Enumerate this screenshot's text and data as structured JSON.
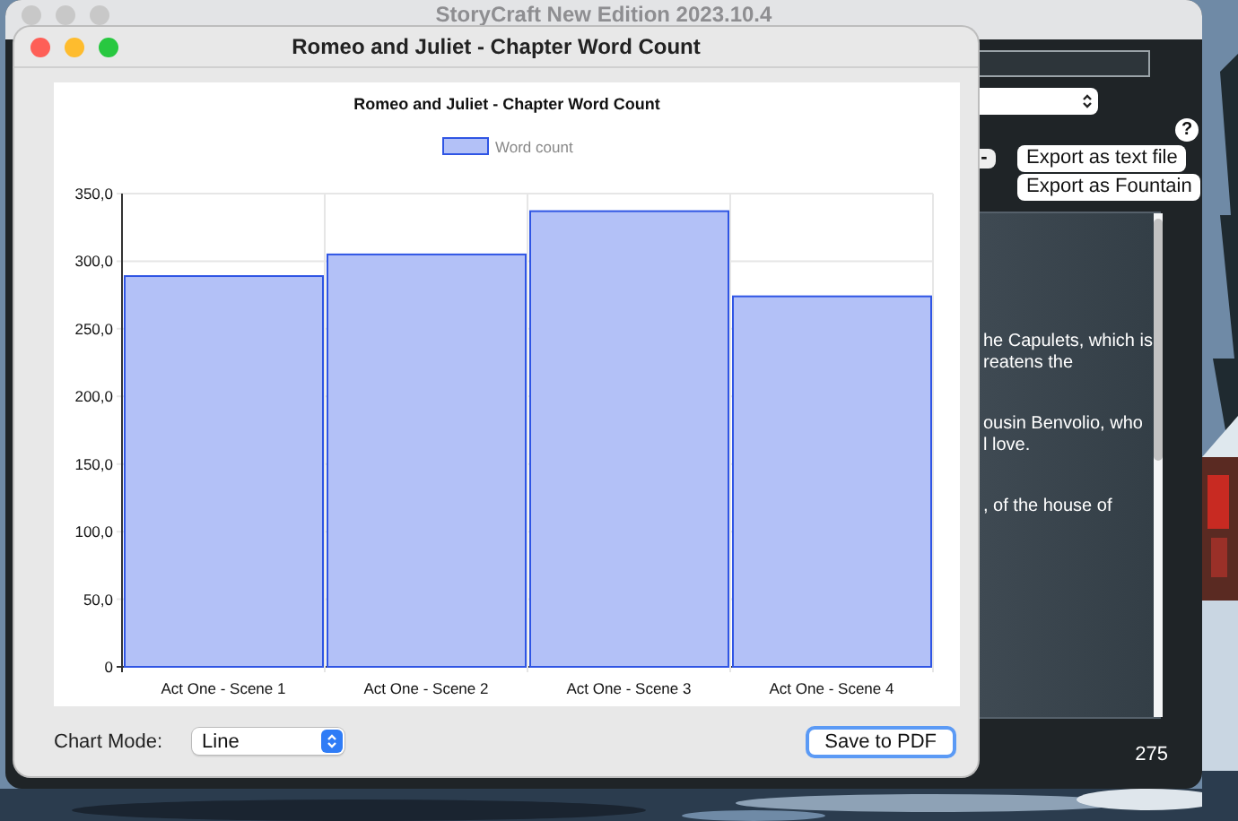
{
  "main_window": {
    "title": "StoryCraft New Edition 2023.10.4",
    "remove_button": "-",
    "help_button": "?",
    "export_buttons": [
      "Export as text file",
      "Export as Fountain"
    ],
    "editor_paragraphs": [
      [
        "he Capulets, which is",
        "reatens the"
      ],
      [
        "ousin Benvolio, who",
        "l love."
      ],
      [
        ", of the house of"
      ]
    ],
    "word_count": "275"
  },
  "chart_window": {
    "title": "Romeo and Juliet - Chapter Word Count",
    "chart_data": {
      "type": "bar",
      "title": "Romeo and Juliet - Chapter Word Count",
      "categories": [
        "Act One - Scene 1",
        "Act One - Scene 2",
        "Act One - Scene 3",
        "Act One - Scene 4"
      ],
      "series": [
        {
          "name": "Word count",
          "color": "#b3c1f7",
          "values": [
            289,
            305,
            337,
            274
          ]
        }
      ],
      "ylim": [
        0,
        350
      ],
      "grid": true,
      "yticks": [
        {
          "value": 0,
          "label": "0"
        },
        {
          "value": 50,
          "label": "50,0"
        },
        {
          "value": 100,
          "label": "100,0"
        },
        {
          "value": 150,
          "label": "150,0"
        },
        {
          "value": 200,
          "label": "200,0"
        },
        {
          "value": 250,
          "label": "250,0"
        },
        {
          "value": 300,
          "label": "300,0"
        },
        {
          "value": 350,
          "label": "350,0"
        }
      ]
    },
    "chart_mode": {
      "label": "Chart Mode:",
      "value": "Line"
    },
    "save_button": "Save to PDF"
  }
}
